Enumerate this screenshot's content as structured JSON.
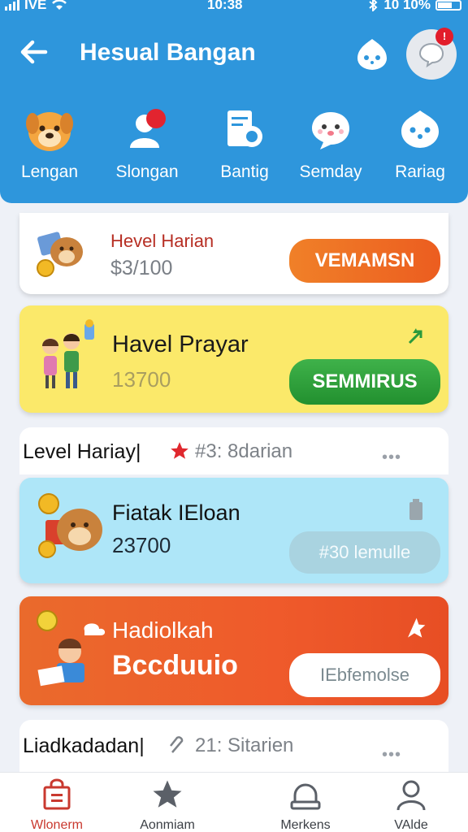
{
  "status_bar": {
    "carrier": "IVE",
    "time": "10:38",
    "battery_text": "10 10%"
  },
  "header": {
    "title": "Hesual Bangan"
  },
  "categories": [
    {
      "label": "Lengan",
      "icon": "dog-face-icon"
    },
    {
      "label": "Slongan",
      "icon": "person-notification-icon"
    },
    {
      "label": "Bantig",
      "icon": "document-camera-icon"
    },
    {
      "label": "Semday",
      "icon": "cute-face-icon"
    },
    {
      "label": "Rariag",
      "icon": "smiley-face-icon"
    }
  ],
  "cards": [
    {
      "title": "Hevel Harian",
      "value": "$3/100",
      "button": "VEMAMSN",
      "icon": "dog-coin-icon"
    },
    {
      "title": "Havel Prayar",
      "value": "13700",
      "button": "SEMMIRUS",
      "icon": "kids-icon",
      "corner_icon": "star-arrow-icon"
    },
    {
      "title": "Level Hariay|",
      "meta": "#3: 8darian",
      "icon": "star-icon"
    },
    {
      "title": "Fiatak IEloan",
      "value": "23700",
      "button": "#30 lemulle",
      "icon": "dog-coin-icon",
      "corner_icon": "battery-icon"
    },
    {
      "title": "Hadiolkah",
      "value": "Bccduuio",
      "button": "IEbfemolse",
      "icon": "reader-coin-icon",
      "corner_icon": "star-arrow-icon"
    },
    {
      "title": "Liadkadadan|",
      "meta": "21: Sitarien",
      "icon": "clip-icon"
    }
  ],
  "bottom_nav": [
    {
      "label": "Wlonerm",
      "icon": "shopping-bag-icon",
      "active": true
    },
    {
      "label": "Aonmiam",
      "icon": "star-icon",
      "active": false
    },
    {
      "label": "Merkens",
      "icon": "archive-icon",
      "active": false
    },
    {
      "label": "VAlde",
      "icon": "user-icon",
      "active": false
    }
  ],
  "colors": {
    "header_bg": "#2e96dc",
    "orange_button": "#f06d22",
    "green_button": "#2a9a3c",
    "card_yellow": "#fbe96a",
    "card_blue": "#aee6f8",
    "card_orange": "#ea6a2c",
    "active_nav": "#c9392f"
  }
}
